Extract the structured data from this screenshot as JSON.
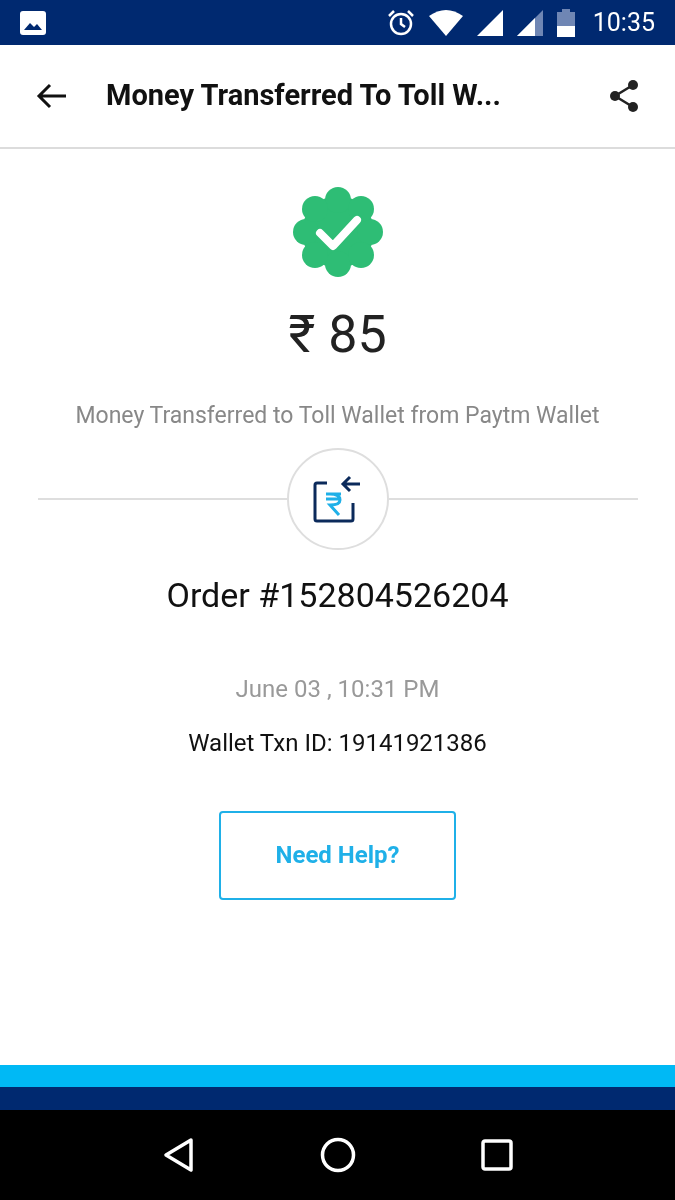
{
  "status_bar": {
    "time": "10:35"
  },
  "header": {
    "title": "Money Transferred To Toll W..."
  },
  "amount": "₹ 85",
  "description": "Money Transferred to Toll Wallet from Paytm Wallet",
  "order": "Order #152804526204",
  "date": "June 03 , 10:31 PM",
  "txn_id": "Wallet Txn ID: 19141921386",
  "help_button": "Need Help?"
}
